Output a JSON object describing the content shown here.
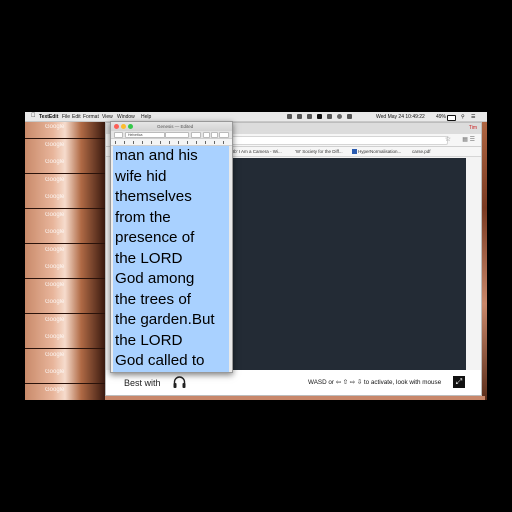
{
  "wallpaper": {
    "tile_label": "Google",
    "tile_count": 17
  },
  "menubar": {
    "apple": "",
    "app_name": "TextEdit",
    "items": [
      "File",
      "Edit",
      "Format",
      "View",
      "Window",
      "Help"
    ],
    "status": "Wed May 24  10:49:22",
    "battery": "49%"
  },
  "browser": {
    "user": "Tim",
    "bookmarks": [
      "'Ib' I Am a Camera - Wi...",
      "'W' Society for the Diff...",
      "HyperNormalisation...",
      "carse.pdf"
    ],
    "best_with": "Best with",
    "hint": "WASD or ⇦ ⇧ ⇨ ⇩ to activate, look with mouse",
    "fullscreen_icon": "⤢"
  },
  "textedit": {
    "title": "Genesis",
    "edited": "— Edited",
    "font_name": "Helvetica",
    "body_text": "man and his\nwife hid\nthemselves\nfrom the\npresence of\nthe LORD\nGod among\nthe trees of\nthe garden.But\nthe LORD\nGod called to"
  }
}
